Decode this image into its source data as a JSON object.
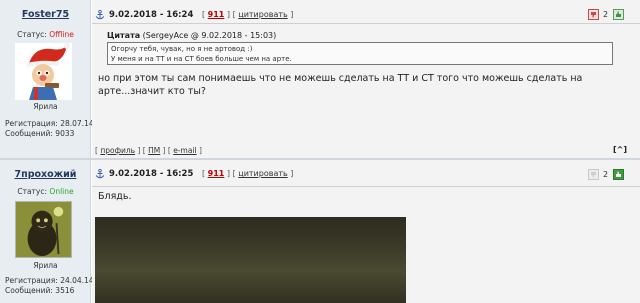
{
  "posts": [
    {
      "author": "Foster75",
      "status_label": "Статус:",
      "status_value": "Offline",
      "rank": "Ярила",
      "reg_label": "Регистрация:",
      "reg_date": "28.07.14",
      "msgs_label": "Сообщений:",
      "msgs_count": "9033",
      "date": "9.02.2018 - 16:24",
      "post_number": "911",
      "quote_link": "цитировать",
      "rating_count": "2",
      "quote": {
        "title": "Цитата",
        "meta": "(SergeyAce @ 9.02.2018 - 15:03)",
        "lines": [
          "Огорчу тебя, чувак, но я не артовод :)",
          "У меня и на ТТ и на СТ боев больше чем на арте."
        ]
      },
      "message": "но при этом ты сам понимаешь что не можешь сделать на ТТ и СТ того что можешь сделать на арте...значит кто ты?",
      "footer": {
        "profile": "профиль",
        "pm": "ПМ",
        "email": "e-mail",
        "top": "[^]"
      },
      "colors": {
        "status": "#d32020"
      },
      "icons": {
        "down": "thumb-down-icon",
        "up": "thumb-up-icon",
        "anchor": "anchor-icon"
      }
    },
    {
      "author": "7прохожий",
      "status_label": "Статус:",
      "status_value": "Online",
      "rank": "Ярила",
      "reg_label": "Регистрация:",
      "reg_date": "24.04.14",
      "msgs_label": "Сообщений:",
      "msgs_count": "3516",
      "date": "9.02.2018 - 16:25",
      "post_number": "911",
      "quote_link": "цитировать",
      "rating_count": "2",
      "message": "Блядь.",
      "colors": {
        "status": "#2aa42a"
      },
      "icons": {
        "down": "thumb-down-icon",
        "up": "thumb-up-icon",
        "anchor": "anchor-icon"
      }
    }
  ]
}
